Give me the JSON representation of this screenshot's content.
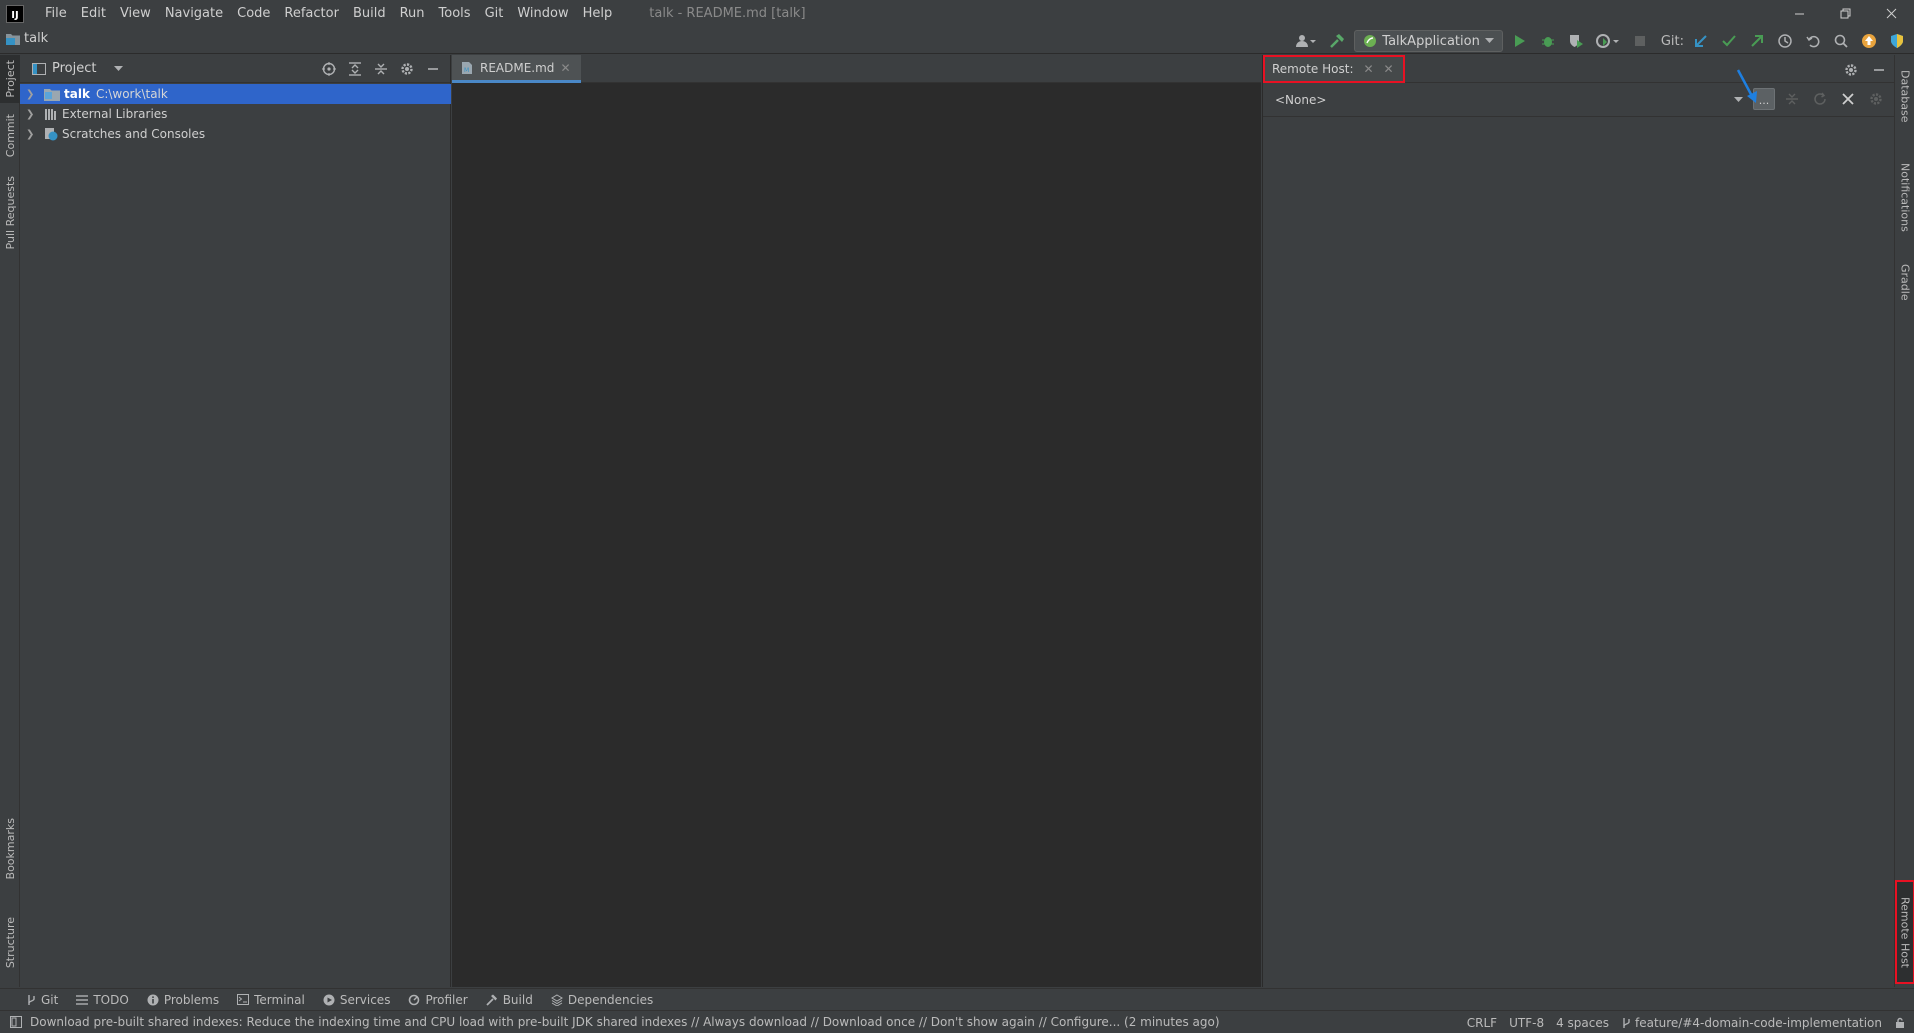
{
  "titlebar": {
    "logo_text": "IJ",
    "menu": [
      "File",
      "Edit",
      "View",
      "Navigate",
      "Code",
      "Refactor",
      "Build",
      "Run",
      "Tools",
      "Git",
      "Window",
      "Help"
    ],
    "window_title": "talk - README.md [talk]"
  },
  "navbar": {
    "project_name": "talk",
    "run_config": "TalkApplication",
    "git_label": "Git:"
  },
  "left_strip": {
    "tabs": [
      "Project",
      "Commit",
      "Pull Requests",
      "Bookmarks",
      "Structure"
    ]
  },
  "right_strip": {
    "tabs": [
      "Database",
      "Notifications",
      "Gradle",
      "Remote Host"
    ]
  },
  "project_panel": {
    "title": "Project",
    "tree": [
      {
        "name": "talk",
        "path": "C:\\work\\talk"
      },
      {
        "name": "External Libraries"
      },
      {
        "name": "Scratches and Consoles"
      }
    ]
  },
  "editor": {
    "tabs": [
      {
        "label": "README.md"
      }
    ]
  },
  "remote_panel": {
    "tab_label": "Remote Host:",
    "host_select": "<None>",
    "browse_label": "..."
  },
  "bottom_tools": [
    "Git",
    "TODO",
    "Problems",
    "Terminal",
    "Services",
    "Profiler",
    "Build",
    "Dependencies"
  ],
  "statusbar": {
    "message": "Download pre-built shared indexes: Reduce the indexing time and CPU load with pre-built JDK shared indexes // Always download // Download once // Don't show again // Configure... (2 minutes ago)",
    "line_separator": "CRLF",
    "encoding": "UTF-8",
    "indent": "4 spaces",
    "branch": "feature/#4-domain-code-implementation"
  },
  "colors": {
    "background": "#3c3f41",
    "editor": "#2b2b2b",
    "selection": "#2f65ca",
    "highlight_box": "#e81123",
    "annotation_arrow": "#1e7fe0"
  }
}
